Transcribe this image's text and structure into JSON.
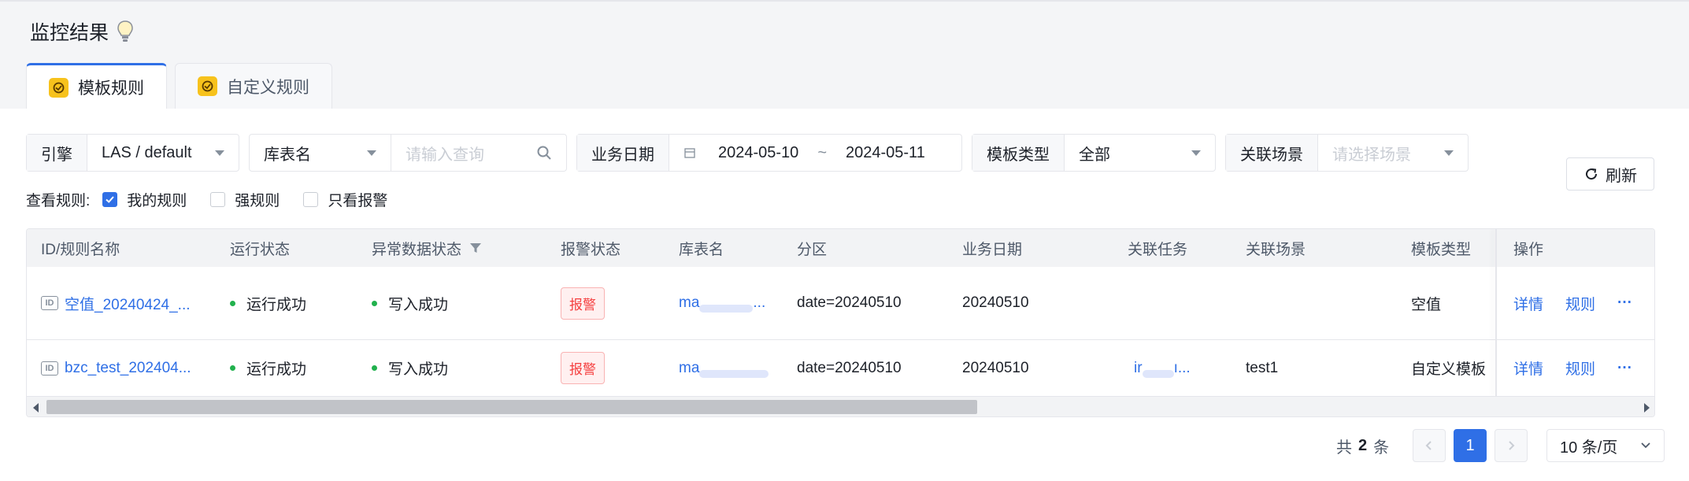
{
  "page": {
    "title": "监控结果"
  },
  "tabs": [
    {
      "label": "模板规则",
      "active": true
    },
    {
      "label": "自定义规则",
      "active": false
    }
  ],
  "filters": {
    "engine": {
      "label": "引擎",
      "value": "LAS / default"
    },
    "table": {
      "label": "库表名",
      "placeholder": "请输入查询"
    },
    "biz_date": {
      "label": "业务日期",
      "start": "2024-05-10",
      "separator": "~",
      "end": "2024-05-11"
    },
    "template_type": {
      "label": "模板类型",
      "value": "全部"
    },
    "scene": {
      "label": "关联场景",
      "placeholder": "请选择场景"
    },
    "refresh_label": "刷新"
  },
  "view_rules": {
    "label": "查看规则:",
    "options": [
      {
        "label": "我的规则",
        "checked": true
      },
      {
        "label": "强规则",
        "checked": false
      },
      {
        "label": "只看报警",
        "checked": false
      }
    ]
  },
  "table": {
    "columns": [
      "ID/规则名称",
      "运行状态",
      "异常数据状态",
      "报警状态",
      "库表名",
      "分区",
      "业务日期",
      "关联任务",
      "关联场景",
      "模板类型",
      "操作"
    ],
    "rows": [
      {
        "id_tag": "ID",
        "name": "空值_20240424_...",
        "run_status": "运行成功",
        "data_status": "写入成功",
        "alarm": "报警",
        "table_name": "ma",
        "table_suffix": "...",
        "partition": "date=20240510",
        "biz_date": "20240510",
        "task": "",
        "task_suffix": "",
        "scene": "",
        "template_type": "空值",
        "actions": {
          "detail": "详情",
          "rule": "规则",
          "more": "···"
        }
      },
      {
        "id_tag": "ID",
        "name": "bzc_test_202404...",
        "run_status": "运行成功",
        "data_status": "写入成功",
        "alarm": "报警",
        "table_name": "ma",
        "table_suffix": "",
        "partition": "date=20240510",
        "biz_date": "20240510",
        "task": "ir",
        "task_suffix": "ı...",
        "scene": "test1",
        "template_type": "自定义模板",
        "actions": {
          "detail": "详情",
          "rule": "规则",
          "more": "···"
        }
      }
    ]
  },
  "pagination": {
    "total_prefix": "共",
    "total": "2",
    "total_suffix": "条",
    "current_page": "1",
    "page_size": "10 条/页"
  },
  "colors": {
    "primary": "#2f6fe6",
    "success": "#21b14d",
    "danger": "#f53f3f",
    "tab_icon": "#f7c21c"
  }
}
